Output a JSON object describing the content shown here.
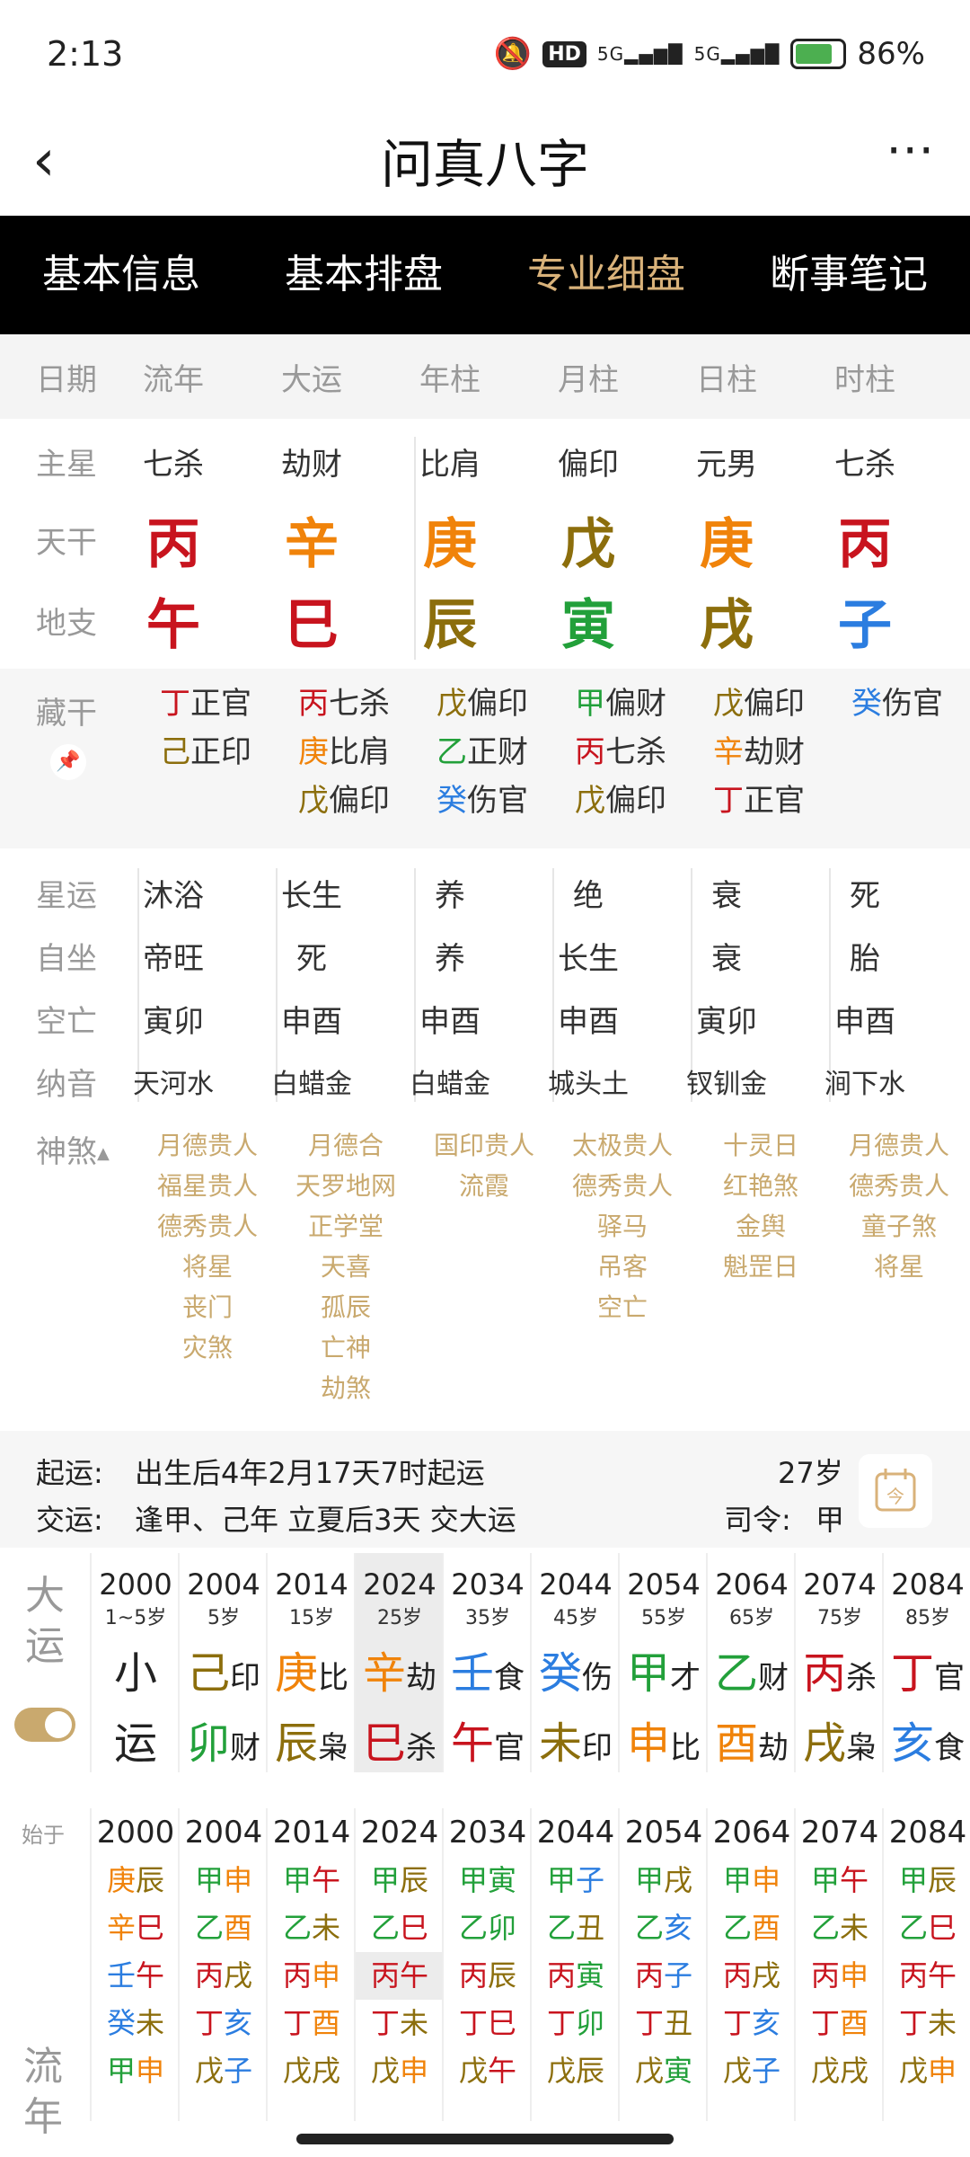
{
  "status": {
    "time": "2:13",
    "hd": "HD",
    "net1": "5G",
    "net2": "5G",
    "battery": "86%"
  },
  "nav": {
    "back_icon": "chevron-left-icon",
    "title": "问真八字",
    "more_icon": "more-icon"
  },
  "tabs": [
    {
      "label": "基本信息"
    },
    {
      "label": "基本排盘"
    },
    {
      "label": "专业细盘"
    },
    {
      "label": "断事笔记"
    }
  ],
  "columns": [
    "日期",
    "流年",
    "大运",
    "年柱",
    "月柱",
    "日柱",
    "时柱"
  ],
  "zhuxing": {
    "label": "主星",
    "values": [
      "七杀",
      "劫财",
      "比肩",
      "偏印",
      "元男",
      "七杀"
    ]
  },
  "tiangan": {
    "label": "天干",
    "values": [
      "丙",
      "辛",
      "庚",
      "戊",
      "庚",
      "丙"
    ],
    "colors": [
      "#c8141e",
      "#f0830a",
      "#f0830a",
      "#8c6e0c",
      "#f0830a",
      "#c8141e"
    ]
  },
  "dizhi": {
    "label": "地支",
    "values": [
      "午",
      "巳",
      "辰",
      "寅",
      "戌",
      "子"
    ],
    "colors": [
      "#c8141e",
      "#c8141e",
      "#8c6e0c",
      "#22a03a",
      "#8c6e0c",
      "#2b7de0"
    ]
  },
  "canggan": {
    "label": "藏干",
    "pin_icon": "pin-icon",
    "cols": [
      [
        [
          "丁",
          "正官",
          "#c8141e"
        ],
        [
          "己",
          "正印",
          "#8c6e0c"
        ]
      ],
      [
        [
          "丙",
          "七杀",
          "#c8141e"
        ],
        [
          "庚",
          "比肩",
          "#f0830a"
        ],
        [
          "戊",
          "偏印",
          "#8c6e0c"
        ]
      ],
      [
        [
          "戊",
          "偏印",
          "#8c6e0c"
        ],
        [
          "乙",
          "正财",
          "#22a03a"
        ],
        [
          "癸",
          "伤官",
          "#2b7de0"
        ]
      ],
      [
        [
          "甲",
          "偏财",
          "#22a03a"
        ],
        [
          "丙",
          "七杀",
          "#c8141e"
        ],
        [
          "戊",
          "偏印",
          "#8c6e0c"
        ]
      ],
      [
        [
          "戊",
          "偏印",
          "#8c6e0c"
        ],
        [
          "辛",
          "劫财",
          "#f0830a"
        ],
        [
          "丁",
          "正官",
          "#c8141e"
        ]
      ],
      [
        [
          "癸",
          "伤官",
          "#2b7de0"
        ]
      ]
    ]
  },
  "xingyun": {
    "label": "星运",
    "values": [
      "沐浴",
      "长生",
      "养",
      "绝",
      "衰",
      "死"
    ]
  },
  "zizuo": {
    "label": "自坐",
    "values": [
      "帝旺",
      "死",
      "养",
      "长生",
      "衰",
      "胎"
    ]
  },
  "kongwang": {
    "label": "空亡",
    "values": [
      "寅卯",
      "申酉",
      "申酉",
      "申酉",
      "寅卯",
      "申酉"
    ]
  },
  "nayin": {
    "label": "纳音",
    "values": [
      "天河水",
      "白蜡金",
      "白蜡金",
      "城头土",
      "钗钏金",
      "涧下水"
    ]
  },
  "shensha": {
    "label": "神煞",
    "cols": [
      [
        "月德贵人",
        "福星贵人",
        "德秀贵人",
        "将星",
        "丧门",
        "灾煞"
      ],
      [
        "月德合",
        "天罗地网",
        "正学堂",
        "天喜",
        "孤辰",
        "亡神",
        "劫煞"
      ],
      [
        "国印贵人",
        "流霞"
      ],
      [
        "太极贵人",
        "德秀贵人",
        "驿马",
        "吊客",
        "空亡"
      ],
      [
        "十灵日",
        "红艳煞",
        "金舆",
        "魁罡日"
      ],
      [
        "月德贵人",
        "德秀贵人",
        "童子煞",
        "将星"
      ]
    ]
  },
  "qiyun": {
    "l1_label": "起运:",
    "l1_text": "出生后4年2月17天7时起运",
    "l2_label": "交运:",
    "l2_text": "逢甲、己年 立夏后3天 交大运",
    "age": "27岁",
    "siling_label": "司令:",
    "siling_value": "甲",
    "calendar_icon": "calendar-icon"
  },
  "dayun": {
    "label1": "大",
    "label2": "运",
    "toggle_icon": "toggle-switch",
    "items": [
      {
        "year": "2000",
        "age": "1~5岁",
        "g": "小",
        "gs": "",
        "z": "运",
        "zs": "",
        "gc": "#222",
        "zc": "#222"
      },
      {
        "year": "2004",
        "age": "5岁",
        "g": "己",
        "gs": "印",
        "z": "卯",
        "zs": "财",
        "gc": "#8c6e0c",
        "zc": "#22a03a"
      },
      {
        "year": "2014",
        "age": "15岁",
        "g": "庚",
        "gs": "比",
        "z": "辰",
        "zs": "枭",
        "gc": "#f0830a",
        "zc": "#8c6e0c"
      },
      {
        "year": "2024",
        "age": "25岁",
        "g": "辛",
        "gs": "劫",
        "z": "巳",
        "zs": "杀",
        "gc": "#f0830a",
        "zc": "#c8141e"
      },
      {
        "year": "2034",
        "age": "35岁",
        "g": "壬",
        "gs": "食",
        "z": "午",
        "zs": "官",
        "gc": "#2b7de0",
        "zc": "#c8141e"
      },
      {
        "year": "2044",
        "age": "45岁",
        "g": "癸",
        "gs": "伤",
        "z": "未",
        "zs": "印",
        "gc": "#2b7de0",
        "zc": "#8c6e0c"
      },
      {
        "year": "2054",
        "age": "55岁",
        "g": "甲",
        "gs": "才",
        "z": "申",
        "zs": "比",
        "gc": "#22a03a",
        "zc": "#f0830a"
      },
      {
        "year": "2064",
        "age": "65岁",
        "g": "乙",
        "gs": "财",
        "z": "酉",
        "zs": "劫",
        "gc": "#22a03a",
        "zc": "#f0830a"
      },
      {
        "year": "2074",
        "age": "75岁",
        "g": "丙",
        "gs": "杀",
        "z": "戌",
        "zs": "枭",
        "gc": "#c8141e",
        "zc": "#8c6e0c"
      },
      {
        "year": "2084",
        "age": "85岁",
        "g": "丁",
        "gs": "官",
        "z": "亥",
        "zs": "食",
        "gc": "#c8141e",
        "zc": "#2b7de0"
      }
    ]
  },
  "liunian": {
    "start_label": "始于",
    "label1": "流",
    "label2": "年",
    "years": [
      "2000",
      "2004",
      "2014",
      "2024",
      "2034",
      "2044",
      "2054",
      "2064",
      "2074",
      "2084"
    ],
    "cols": [
      [
        [
          "庚辰",
          "#f0830a",
          "#8c6e0c"
        ],
        [
          "辛巳",
          "#f0830a",
          "#c8141e"
        ],
        [
          "壬午",
          "#2b7de0",
          "#c8141e"
        ],
        [
          "癸未",
          "#2b7de0",
          "#8c6e0c"
        ],
        [
          "甲申",
          "#22a03a",
          "#f0830a"
        ]
      ],
      [
        [
          "甲申",
          "#22a03a",
          "#f0830a"
        ],
        [
          "乙酉",
          "#22a03a",
          "#f0830a"
        ],
        [
          "丙戌",
          "#c8141e",
          "#8c6e0c"
        ],
        [
          "丁亥",
          "#c8141e",
          "#2b7de0"
        ],
        [
          "戊子",
          "#8c6e0c",
          "#2b7de0"
        ]
      ],
      [
        [
          "甲午",
          "#22a03a",
          "#c8141e"
        ],
        [
          "乙未",
          "#22a03a",
          "#8c6e0c"
        ],
        [
          "丙申",
          "#c8141e",
          "#f0830a"
        ],
        [
          "丁酉",
          "#c8141e",
          "#f0830a"
        ],
        [
          "戊戌",
          "#8c6e0c",
          "#8c6e0c"
        ]
      ],
      [
        [
          "甲辰",
          "#22a03a",
          "#8c6e0c"
        ],
        [
          "乙巳",
          "#22a03a",
          "#c8141e"
        ],
        [
          "丙午",
          "#c8141e",
          "#c8141e"
        ],
        [
          "丁未",
          "#c8141e",
          "#8c6e0c"
        ],
        [
          "戊申",
          "#8c6e0c",
          "#f0830a"
        ]
      ],
      [
        [
          "甲寅",
          "#22a03a",
          "#22a03a"
        ],
        [
          "乙卯",
          "#22a03a",
          "#22a03a"
        ],
        [
          "丙辰",
          "#c8141e",
          "#8c6e0c"
        ],
        [
          "丁巳",
          "#c8141e",
          "#c8141e"
        ],
        [
          "戊午",
          "#8c6e0c",
          "#c8141e"
        ]
      ],
      [
        [
          "甲子",
          "#22a03a",
          "#2b7de0"
        ],
        [
          "乙丑",
          "#22a03a",
          "#8c6e0c"
        ],
        [
          "丙寅",
          "#c8141e",
          "#22a03a"
        ],
        [
          "丁卯",
          "#c8141e",
          "#22a03a"
        ],
        [
          "戊辰",
          "#8c6e0c",
          "#8c6e0c"
        ]
      ],
      [
        [
          "甲戌",
          "#22a03a",
          "#8c6e0c"
        ],
        [
          "乙亥",
          "#22a03a",
          "#2b7de0"
        ],
        [
          "丙子",
          "#c8141e",
          "#2b7de0"
        ],
        [
          "丁丑",
          "#c8141e",
          "#8c6e0c"
        ],
        [
          "戊寅",
          "#8c6e0c",
          "#22a03a"
        ]
      ],
      [
        [
          "甲申",
          "#22a03a",
          "#f0830a"
        ],
        [
          "乙酉",
          "#22a03a",
          "#f0830a"
        ],
        [
          "丙戌",
          "#c8141e",
          "#8c6e0c"
        ],
        [
          "丁亥",
          "#c8141e",
          "#2b7de0"
        ],
        [
          "戊子",
          "#8c6e0c",
          "#2b7de0"
        ]
      ],
      [
        [
          "甲午",
          "#22a03a",
          "#c8141e"
        ],
        [
          "乙未",
          "#22a03a",
          "#8c6e0c"
        ],
        [
          "丙申",
          "#c8141e",
          "#f0830a"
        ],
        [
          "丁酉",
          "#c8141e",
          "#f0830a"
        ],
        [
          "戊戌",
          "#8c6e0c",
          "#8c6e0c"
        ]
      ],
      [
        [
          "甲辰",
          "#22a03a",
          "#8c6e0c"
        ],
        [
          "乙巳",
          "#22a03a",
          "#c8141e"
        ],
        [
          "丙午",
          "#c8141e",
          "#c8141e"
        ],
        [
          "丁未",
          "#c8141e",
          "#8c6e0c"
        ],
        [
          "戊申",
          "#8c6e0c",
          "#f0830a"
        ]
      ]
    ]
  }
}
